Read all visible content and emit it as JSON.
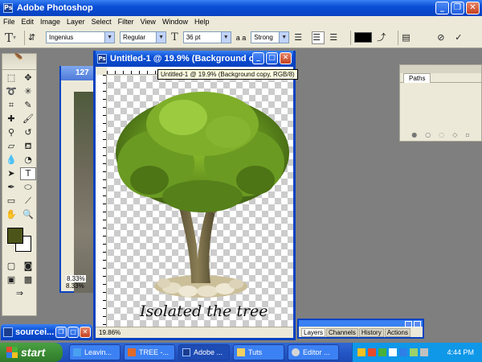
{
  "app": {
    "title": "Adobe Photoshop"
  },
  "menu": [
    "File",
    "Edit",
    "Image",
    "Layer",
    "Select",
    "Filter",
    "View",
    "Window",
    "Help"
  ],
  "options": {
    "font_family": "Ingenius",
    "font_style": "Regular",
    "font_size": "36 pt",
    "antialias_icon_label": "a a",
    "antialias": "Strong",
    "text_color": "#000000"
  },
  "toolbox": {
    "foreground_color": "#4d5419",
    "background_color": "#ffffff"
  },
  "background_doc": {
    "title": "127",
    "zoom": "8.33%",
    "zoom_inner": "8.33%"
  },
  "document": {
    "title": "Untitled-1 @ 19.9% (Background c...",
    "zoom": "19.86%",
    "caption": "Isolated the tree"
  },
  "tooltip": "Untitled-1 @ 19.9% (Background copy, RGB/8)",
  "paths_panel": {
    "tab": "Paths"
  },
  "layers_panel": {
    "tabs": [
      "Layers",
      "Channels",
      "History",
      "Actions"
    ]
  },
  "minimized": {
    "title": "sourcei..."
  },
  "taskbar": {
    "start": "start",
    "tasks": [
      "Leavin...",
      "TREE -...",
      "Adobe ...",
      "Tuts",
      "Editor ..."
    ],
    "clock": "4:44 PM"
  }
}
